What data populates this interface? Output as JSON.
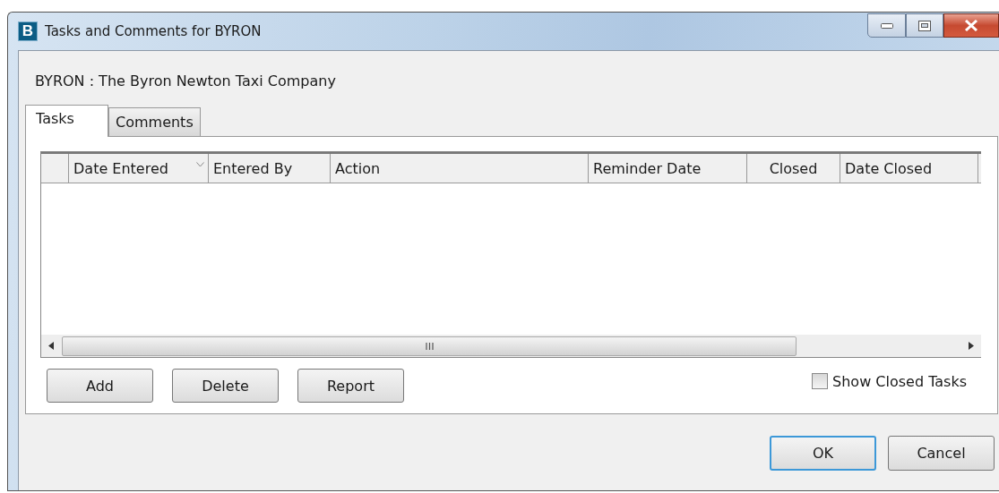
{
  "window": {
    "icon_letter": "B",
    "title": "Tasks and Comments for BYRON"
  },
  "heading": "BYRON : The Byron Newton Taxi Company",
  "tabs": [
    {
      "label": "Tasks",
      "selected": true
    },
    {
      "label": "Comments",
      "selected": false
    }
  ],
  "table": {
    "columns": [
      {
        "label": "Date Entered",
        "sorted": true
      },
      {
        "label": "Entered By",
        "sorted": false
      },
      {
        "label": "Action",
        "sorted": false
      },
      {
        "label": "Reminder Date",
        "sorted": false
      },
      {
        "label": "Closed",
        "sorted": false
      },
      {
        "label": "Date Closed",
        "sorted": false
      }
    ]
  },
  "actions": [
    "Add",
    "Delete",
    "Report"
  ],
  "show_closed": {
    "label": "Show Closed Tasks",
    "checked": false
  },
  "buttons": [
    {
      "label": "OK",
      "default": true
    },
    {
      "label": "Cancel",
      "default": false
    }
  ]
}
